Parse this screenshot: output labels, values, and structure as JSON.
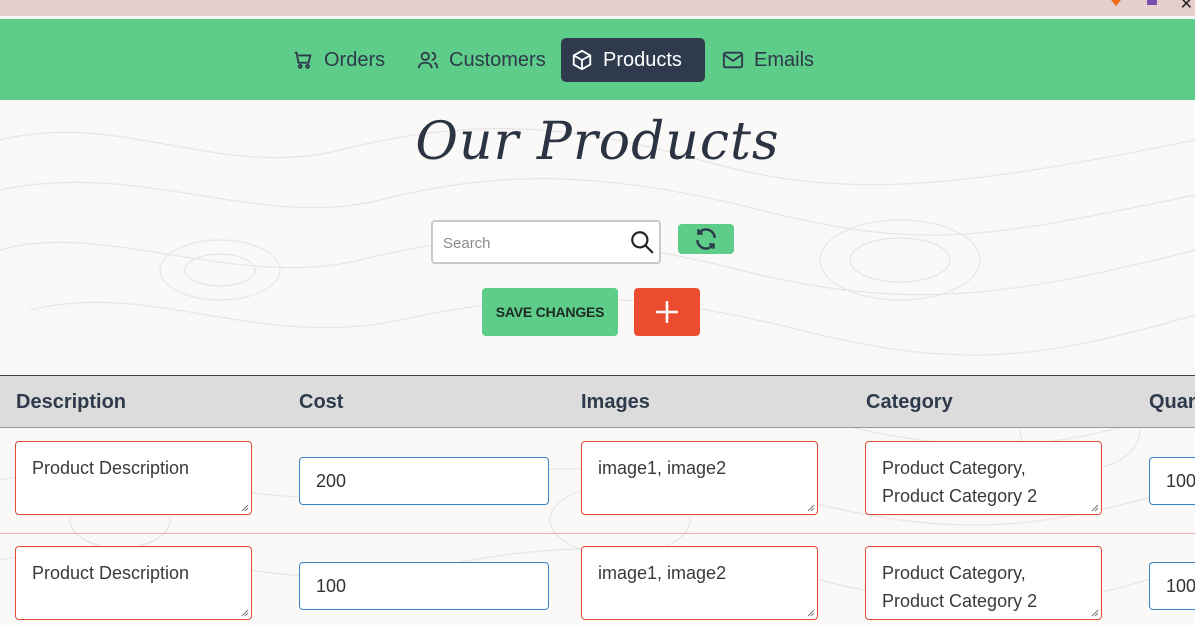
{
  "nav": {
    "items": [
      {
        "label": "Orders",
        "icon": "cart-icon"
      },
      {
        "label": "Customers",
        "icon": "users-icon"
      },
      {
        "label": "Products",
        "icon": "box-icon",
        "active": true
      },
      {
        "label": "Emails",
        "icon": "mail-icon"
      }
    ]
  },
  "page": {
    "title": "Our Products"
  },
  "search": {
    "placeholder": "Search",
    "value": ""
  },
  "actions": {
    "save_label": "SAVE CHANGES",
    "add_label": "+"
  },
  "table": {
    "headers": [
      "Description",
      "Cost",
      "Images",
      "Category",
      "Quan"
    ],
    "rows": [
      {
        "description": "Product Description",
        "cost": "200",
        "images": "image1, image2",
        "category": "Product Category, Product Category 2",
        "quantity": "100"
      },
      {
        "description": "Product Description",
        "cost": "100",
        "images": "image1, image2",
        "category": "Product Category, Product Category 2",
        "quantity": "100"
      }
    ]
  },
  "colors": {
    "nav_bg": "#5fcd8a",
    "nav_active": "#2f3b4c",
    "add_button": "#ec4d31",
    "textarea_border": "#e14b36",
    "input_border": "#3b82c4"
  }
}
